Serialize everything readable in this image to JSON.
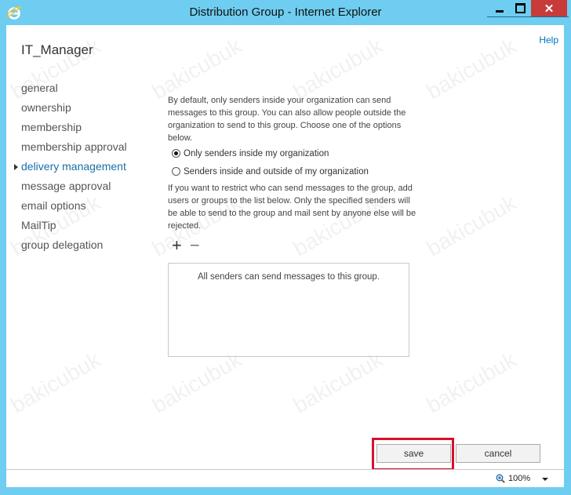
{
  "window": {
    "title": "Distribution Group - Internet Explorer",
    "close_glyph": "✕"
  },
  "help_label": "Help",
  "page_title": "IT_Manager",
  "nav": {
    "items": [
      {
        "label": "general",
        "active": false
      },
      {
        "label": "ownership",
        "active": false
      },
      {
        "label": "membership",
        "active": false
      },
      {
        "label": "membership approval",
        "active": false
      },
      {
        "label": "delivery management",
        "active": true
      },
      {
        "label": "message approval",
        "active": false
      },
      {
        "label": "email options",
        "active": false
      },
      {
        "label": "MailTip",
        "active": false
      },
      {
        "label": "group delegation",
        "active": false
      }
    ]
  },
  "delivery": {
    "intro": "By default, only senders inside your organization can send messages to this group. You can also allow people outside the organization to send to this group. Choose one of the options below.",
    "options": [
      {
        "label": "Only senders inside my organization",
        "selected": true
      },
      {
        "label": "Senders inside and outside of my organization",
        "selected": false
      }
    ],
    "restrict_text": "If you want to restrict who can send messages to the group, add users or groups to the list below. Only the specified senders will be able to send to the group and mail sent by anyone else will be rejected.",
    "add_glyph": "+",
    "remove_glyph": "−",
    "list_empty_text": "All senders can send messages to this group."
  },
  "actions": {
    "save_label": "save",
    "cancel_label": "cancel"
  },
  "status": {
    "zoom": "100%"
  },
  "watermark_text": "bakicubuk",
  "colors": {
    "chrome": "#6ecdf0",
    "close_button": "#c73b3b",
    "link": "#0072c6",
    "active_nav": "#1a6fa8",
    "highlight": "#d8102a"
  }
}
